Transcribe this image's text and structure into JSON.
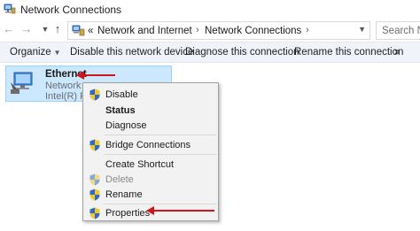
{
  "window": {
    "title": "Network Connections",
    "icon": "network-connections-icon"
  },
  "address": {
    "chevrons": "«",
    "crumbs": [
      "Network and Internet",
      "Network Connections"
    ],
    "search_placeholder": "Search N"
  },
  "commandbar": {
    "organize": "Organize",
    "disable": "Disable this network device",
    "diagnose": "Diagnose this connection",
    "rename": "Rename this connection",
    "more": "»"
  },
  "adapter": {
    "name": "Ethernet",
    "status": "Network",
    "device": "Intel(R) PR"
  },
  "context_menu": {
    "items": [
      {
        "label": "Disable",
        "shield": true,
        "bold": false,
        "disabled": false
      },
      {
        "label": "Status",
        "shield": false,
        "bold": true,
        "disabled": false
      },
      {
        "label": "Diagnose",
        "shield": false,
        "bold": false,
        "disabled": false
      },
      {
        "label": "Bridge Connections",
        "shield": true,
        "bold": false,
        "disabled": false
      },
      {
        "label": "Create Shortcut",
        "shield": false,
        "bold": false,
        "disabled": false
      },
      {
        "label": "Delete",
        "shield": true,
        "bold": false,
        "disabled": true
      },
      {
        "label": "Rename",
        "shield": true,
        "bold": false,
        "disabled": false
      },
      {
        "label": "Properties",
        "shield": true,
        "bold": false,
        "disabled": false
      }
    ]
  },
  "colors": {
    "selection": "#cce8ff",
    "annotation_arrow": "#d0141a",
    "commandbar": "#f0f3f9"
  }
}
